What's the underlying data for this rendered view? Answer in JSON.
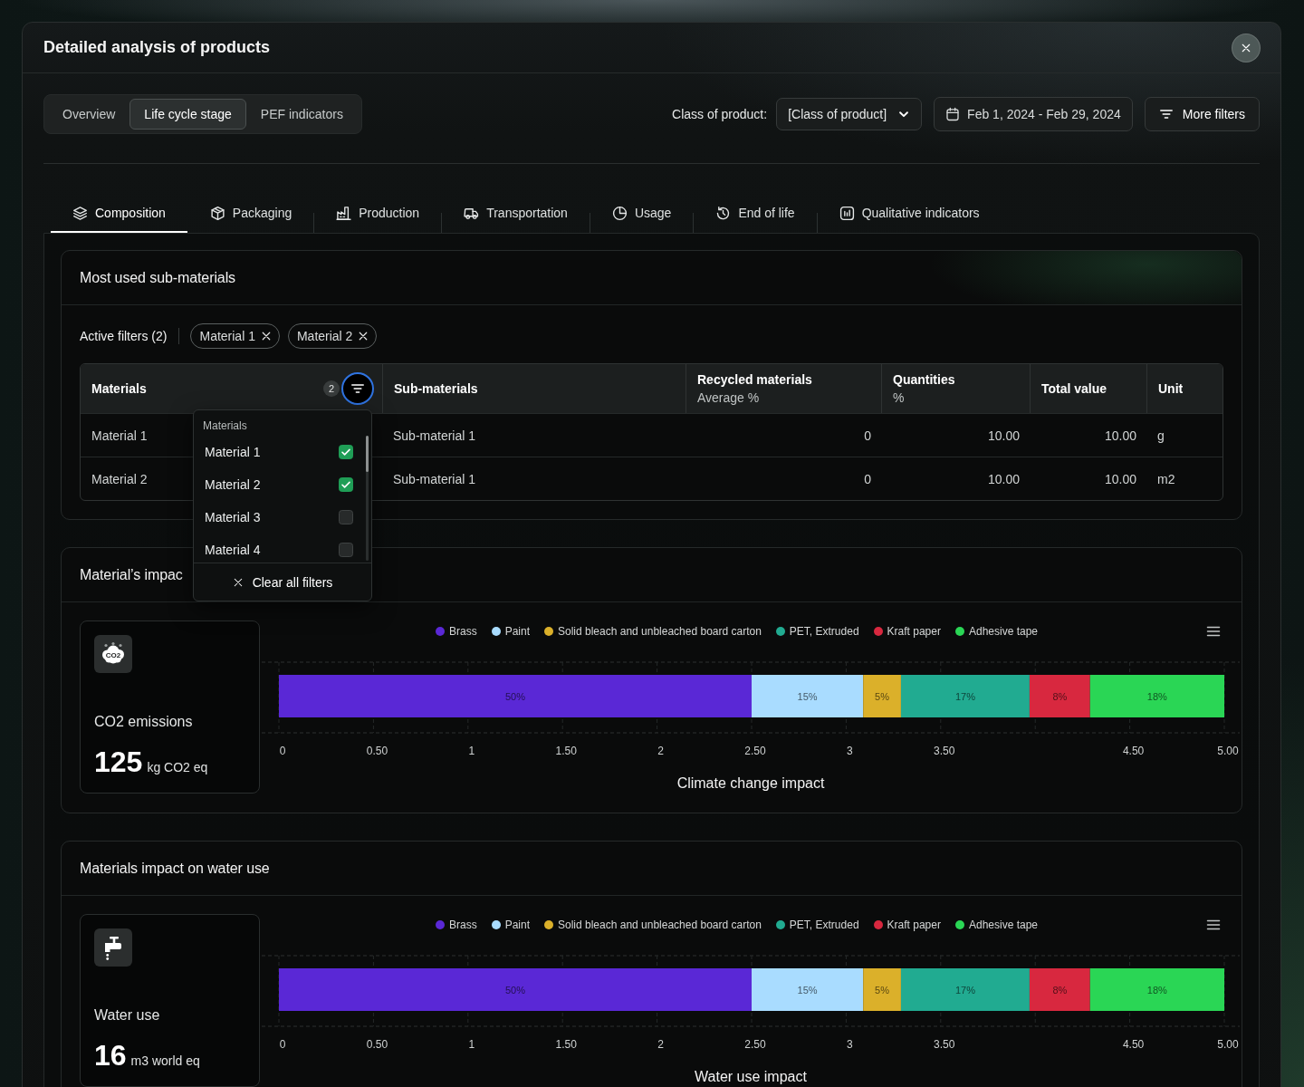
{
  "window": {
    "title": "Detailed analysis of products"
  },
  "view_tabs": [
    {
      "label": "Overview",
      "selected": false
    },
    {
      "label": "Life cycle stage",
      "selected": true
    },
    {
      "label": "PEF indicators",
      "selected": false
    }
  ],
  "filters": {
    "class_label": "Class of product:",
    "class_value": "[Class of product]",
    "date_range": "Feb 1, 2024 - Feb 29, 2024",
    "more_filters": "More filters"
  },
  "stage_tabs": [
    {
      "label": "Composition",
      "selected": true
    },
    {
      "label": "Packaging",
      "selected": false
    },
    {
      "label": "Production",
      "selected": false
    },
    {
      "label": "Transportation",
      "selected": false
    },
    {
      "label": "Usage",
      "selected": false
    },
    {
      "label": "End of life",
      "selected": false
    },
    {
      "label": "Qualitative indicators",
      "selected": false
    }
  ],
  "sub_materials": {
    "title": "Most used sub-materials",
    "active_filters": {
      "label": "Active filters (2)",
      "chips": [
        "Material 1",
        "Material 2"
      ]
    },
    "table": {
      "columns": [
        {
          "title": "Materials",
          "kind": "text",
          "filter_count": "2",
          "filter_open": true
        },
        {
          "title": "Sub-materials",
          "kind": "text"
        },
        {
          "title": "Recycled materials",
          "subtitle": "Average %",
          "kind": "number"
        },
        {
          "title": "Quantities",
          "subtitle": "%",
          "kind": "number"
        },
        {
          "title": "Total value",
          "kind": "number"
        },
        {
          "title": "Unit",
          "kind": "text"
        }
      ],
      "rows": [
        [
          "Material 1",
          "Sub-material 1",
          "0",
          "10.00",
          "10.00",
          "g"
        ],
        [
          "Material 2",
          "Sub-material 1",
          "0",
          "10.00",
          "10.00",
          "m2"
        ]
      ]
    },
    "filter_menu": {
      "heading": "Materials",
      "options": [
        {
          "label": "Material 1",
          "checked": true
        },
        {
          "label": "Material 2",
          "checked": true
        },
        {
          "label": "Material 3",
          "checked": false
        },
        {
          "label": "Material 4",
          "checked": false
        }
      ],
      "clear_label": "Clear all filters"
    }
  },
  "impact_cards": [
    {
      "title": "Material’s impac",
      "kpi": {
        "label": "CO2 emissions",
        "value": "125",
        "unit": "kg CO2 eq",
        "icon_text": "CO2"
      },
      "chart_data": {
        "type": "bar",
        "orientation": "horizontal",
        "stacked": true,
        "xlabel": "Climate change impact",
        "xlim": [
          0,
          5
        ],
        "xticks": [
          {
            "value": 0,
            "label": "0"
          },
          {
            "value": 0.5,
            "label": "0.50"
          },
          {
            "value": 1,
            "label": "1"
          },
          {
            "value": 1.5,
            "label": "1.50"
          },
          {
            "value": 2,
            "label": "2"
          },
          {
            "value": 2.5,
            "label": "2.50"
          },
          {
            "value": 3,
            "label": "3"
          },
          {
            "value": 3.5,
            "label": "3.50"
          },
          {
            "value": 4.5,
            "label": "4.50"
          },
          {
            "value": 5,
            "label": "5.00"
          }
        ],
        "grid": true,
        "legend": true,
        "series": [
          {
            "name": "Brass",
            "color": "#5a28d6",
            "values": [
              2.5
            ]
          },
          {
            "name": "Paint",
            "color": "#a9dcff",
            "values": [
              0.59
            ]
          },
          {
            "name": "Solid bleach and unbleached board carton",
            "color": "#dbb02a",
            "values": [
              0.2
            ]
          },
          {
            "name": "PET, Extruded",
            "color": "#21ab91",
            "values": [
              0.68
            ]
          },
          {
            "name": "Kraft paper",
            "color": "#d8283f",
            "values": [
              0.32
            ]
          },
          {
            "name": "Adhesive tape",
            "color": "#2ad655",
            "values": [
              0.71
            ]
          }
        ],
        "value_labels": [
          "50%",
          "15%",
          "5%",
          "17%",
          "8%",
          "18%"
        ]
      }
    },
    {
      "title": "Materials impact on water use",
      "kpi": {
        "label": "Water use",
        "value": "16",
        "unit": "m3 world eq"
      },
      "chart_data": {
        "type": "bar",
        "orientation": "horizontal",
        "stacked": true,
        "xlabel": "Water use impact",
        "xlim": [
          0,
          5
        ],
        "xticks": [
          {
            "value": 0,
            "label": "0"
          },
          {
            "value": 0.5,
            "label": "0.50"
          },
          {
            "value": 1,
            "label": "1"
          },
          {
            "value": 1.5,
            "label": "1.50"
          },
          {
            "value": 2,
            "label": "2"
          },
          {
            "value": 2.5,
            "label": "2.50"
          },
          {
            "value": 3,
            "label": "3"
          },
          {
            "value": 3.5,
            "label": "3.50"
          },
          {
            "value": 4.5,
            "label": "4.50"
          },
          {
            "value": 5,
            "label": "5.00"
          }
        ],
        "grid": true,
        "legend": true,
        "series": [
          {
            "name": "Brass",
            "color": "#5a28d6",
            "values": [
              2.5
            ]
          },
          {
            "name": "Paint",
            "color": "#a9dcff",
            "values": [
              0.59
            ]
          },
          {
            "name": "Solid bleach and unbleached board carton",
            "color": "#dbb02a",
            "values": [
              0.2
            ]
          },
          {
            "name": "PET, Extruded",
            "color": "#21ab91",
            "values": [
              0.68
            ]
          },
          {
            "name": "Kraft paper",
            "color": "#d8283f",
            "values": [
              0.32
            ]
          },
          {
            "name": "Adhesive tape",
            "color": "#2ad655",
            "values": [
              0.71
            ]
          }
        ],
        "value_labels": [
          "50%",
          "15%",
          "5%",
          "17%",
          "8%",
          "18%"
        ]
      }
    }
  ]
}
